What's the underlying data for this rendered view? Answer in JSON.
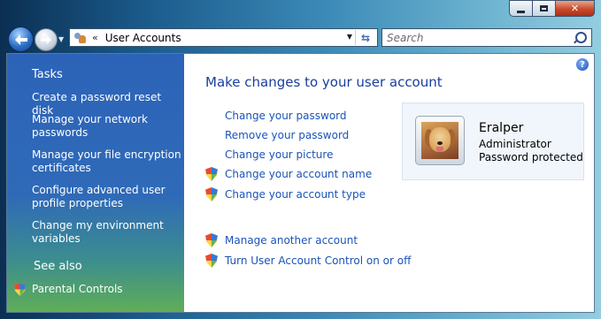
{
  "window": {
    "address": "User Accounts",
    "address_chevron": "«",
    "search_placeholder": "Search"
  },
  "sidebar": {
    "tasks_title": "Tasks",
    "links": [
      {
        "label": "Create a password reset disk"
      },
      {
        "label": "Manage your network passwords"
      },
      {
        "label": "Manage your file encryption certificates"
      },
      {
        "label": "Configure advanced user profile properties"
      },
      {
        "label": "Change my environment variables"
      }
    ],
    "see_also_title": "See also",
    "see_also_links": [
      {
        "label": "Parental Controls"
      }
    ]
  },
  "main": {
    "heading": "Make changes to your user account",
    "links": [
      {
        "label": "Change your password",
        "shield": false
      },
      {
        "label": "Remove your password",
        "shield": false
      },
      {
        "label": "Change your picture",
        "shield": false
      },
      {
        "label": "Change your account name",
        "shield": true
      },
      {
        "label": "Change your account type",
        "shield": true
      },
      {
        "label": "Manage another account",
        "shield": true
      },
      {
        "label": "Turn User Account Control on or off",
        "shield": true
      }
    ]
  },
  "user": {
    "name": "Eralper",
    "role": "Administrator",
    "status": "Password protected"
  },
  "colors": {
    "link": "#1a53b8",
    "heading": "#1a3e9f",
    "sidebar_top": "#2c63b8",
    "sidebar_bottom": "#5fae57"
  }
}
